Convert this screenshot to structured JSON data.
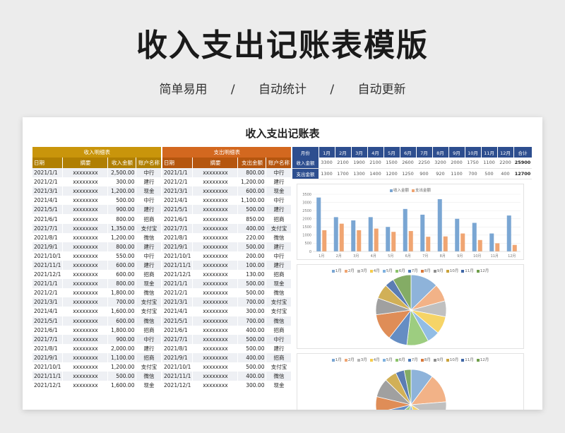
{
  "header": {
    "title": "收入支出记账表模版",
    "taglines": [
      "简单易用",
      "/",
      "自动统计",
      "/",
      "自动更新"
    ]
  },
  "sheet": {
    "title": "收入支出记账表",
    "income": {
      "section_title": "收入明细表",
      "columns": [
        "日期",
        "摘要",
        "收入金额",
        "账户名称"
      ],
      "rows": [
        [
          "2021/1/1",
          "xxxxxxxx",
          "2,500.00",
          "中行"
        ],
        [
          "2021/2/1",
          "xxxxxxxx",
          "300.00",
          "建行"
        ],
        [
          "2021/3/1",
          "xxxxxxxx",
          "1,200.00",
          "现金"
        ],
        [
          "2021/4/1",
          "xxxxxxxx",
          "500.00",
          "中行"
        ],
        [
          "2021/5/1",
          "xxxxxxxx",
          "900.00",
          "建行"
        ],
        [
          "2021/6/1",
          "xxxxxxxx",
          "800.00",
          "招商"
        ],
        [
          "2021/7/1",
          "xxxxxxxx",
          "1,350.00",
          "支付宝"
        ],
        [
          "2021/8/1",
          "xxxxxxxx",
          "1,200.00",
          "微信"
        ],
        [
          "2021/9/1",
          "xxxxxxxx",
          "800.00",
          "建行"
        ],
        [
          "2021/10/1",
          "xxxxxxxx",
          "550.00",
          "中行"
        ],
        [
          "2021/11/1",
          "xxxxxxxx",
          "600.00",
          "建行"
        ],
        [
          "2021/12/1",
          "xxxxxxxx",
          "600.00",
          "招商"
        ],
        [
          "2021/1/1",
          "xxxxxxxx",
          "800.00",
          "现金"
        ],
        [
          "2021/2/1",
          "xxxxxxxx",
          "1,800.00",
          "微信"
        ],
        [
          "2021/3/1",
          "xxxxxxxx",
          "700.00",
          "支付宝"
        ],
        [
          "2021/4/1",
          "xxxxxxxx",
          "1,600.00",
          "支付宝"
        ],
        [
          "2021/5/1",
          "xxxxxxxx",
          "600.00",
          "微信"
        ],
        [
          "2021/6/1",
          "xxxxxxxx",
          "1,800.00",
          "招商"
        ],
        [
          "2021/7/1",
          "xxxxxxxx",
          "900.00",
          "中行"
        ],
        [
          "2021/8/1",
          "xxxxxxxx",
          "2,000.00",
          "建行"
        ],
        [
          "2021/9/1",
          "xxxxxxxx",
          "1,100.00",
          "招商"
        ],
        [
          "2021/10/1",
          "xxxxxxxx",
          "1,200.00",
          "支付宝"
        ],
        [
          "2021/11/1",
          "xxxxxxxx",
          "500.00",
          "微信"
        ],
        [
          "2021/12/1",
          "xxxxxxxx",
          "1,600.00",
          "现金"
        ]
      ]
    },
    "expense": {
      "section_title": "支出明细表",
      "columns": [
        "日期",
        "摘要",
        "支出金额",
        "账户名称"
      ],
      "rows": [
        [
          "2021/1/1",
          "xxxxxxxx",
          "800.00",
          "中行"
        ],
        [
          "2021/2/1",
          "xxxxxxxx",
          "1,200.00",
          "建行"
        ],
        [
          "2021/3/1",
          "xxxxxxxx",
          "600.00",
          "现金"
        ],
        [
          "2021/4/1",
          "xxxxxxxx",
          "1,100.00",
          "中行"
        ],
        [
          "2021/5/1",
          "xxxxxxxx",
          "500.00",
          "建行"
        ],
        [
          "2021/6/1",
          "xxxxxxxx",
          "850.00",
          "招商"
        ],
        [
          "2021/7/1",
          "xxxxxxxx",
          "400.00",
          "支付宝"
        ],
        [
          "2021/8/1",
          "xxxxxxxx",
          "220.00",
          "微信"
        ],
        [
          "2021/9/1",
          "xxxxxxxx",
          "500.00",
          "建行"
        ],
        [
          "2021/10/1",
          "xxxxxxxx",
          "200.00",
          "中行"
        ],
        [
          "2021/11/1",
          "xxxxxxxx",
          "100.00",
          "建行"
        ],
        [
          "2021/12/1",
          "xxxxxxxx",
          "130.00",
          "招商"
        ],
        [
          "2021/1/1",
          "xxxxxxxx",
          "500.00",
          "现金"
        ],
        [
          "2021/2/1",
          "xxxxxxxx",
          "500.00",
          "微信"
        ],
        [
          "2021/3/1",
          "xxxxxxxx",
          "700.00",
          "支付宝"
        ],
        [
          "2021/4/1",
          "xxxxxxxx",
          "300.00",
          "支付宝"
        ],
        [
          "2021/5/1",
          "xxxxxxxx",
          "700.00",
          "微信"
        ],
        [
          "2021/6/1",
          "xxxxxxxx",
          "400.00",
          "招商"
        ],
        [
          "2021/7/1",
          "xxxxxxxx",
          "500.00",
          "中行"
        ],
        [
          "2021/8/1",
          "xxxxxxxx",
          "500.00",
          "建行"
        ],
        [
          "2021/9/1",
          "xxxxxxxx",
          "400.00",
          "招商"
        ],
        [
          "2021/10/1",
          "xxxxxxxx",
          "500.00",
          "支付宝"
        ],
        [
          "2021/11/1",
          "xxxxxxxx",
          "400.00",
          "微信"
        ],
        [
          "2021/12/1",
          "xxxxxxxx",
          "300.00",
          "现金"
        ]
      ]
    },
    "summary": {
      "columns": [
        "月份",
        "1月",
        "2月",
        "3月",
        "4月",
        "5月",
        "6月",
        "7月",
        "8月",
        "9月",
        "10月",
        "11月",
        "12月",
        "合计"
      ],
      "rows": [
        {
          "label": "收入金额",
          "values": [
            "3300",
            "2100",
            "1900",
            "2100",
            "1500",
            "2600",
            "2250",
            "3200",
            "2000",
            "1750",
            "1100",
            "2200"
          ],
          "total": "25900"
        },
        {
          "label": "支出金额",
          "values": [
            "1300",
            "1700",
            "1300",
            "1400",
            "1200",
            "1250",
            "900",
            "920",
            "1100",
            "700",
            "500",
            "400"
          ],
          "total": "12700"
        }
      ]
    }
  },
  "chart_data": [
    {
      "type": "bar",
      "categories": [
        "1月",
        "2月",
        "3月",
        "4月",
        "5月",
        "6月",
        "7月",
        "8月",
        "9月",
        "10月",
        "11月",
        "12月"
      ],
      "series": [
        {
          "name": "收入金额",
          "values": [
            3300,
            2100,
            1900,
            2100,
            1500,
            2600,
            2250,
            3200,
            2000,
            1750,
            1100,
            2200
          ],
          "color": "#7aa6d3"
        },
        {
          "name": "支出金额",
          "values": [
            1300,
            1700,
            1300,
            1400,
            1200,
            1250,
            900,
            920,
            1100,
            700,
            500,
            400
          ],
          "color": "#f0a572"
        }
      ],
      "ylim": [
        0,
        3500
      ],
      "yticks": [
        "0",
        "500",
        "1000",
        "1500",
        "2000",
        "2500",
        "3000",
        "3500"
      ],
      "grid": true,
      "legend": "top"
    },
    {
      "type": "pie",
      "categories": [
        "1月",
        "2月",
        "3月",
        "4月",
        "5月",
        "6月",
        "7月",
        "8月",
        "9月",
        "10月",
        "11月",
        "12月"
      ],
      "values": [
        3300,
        2100,
        1900,
        2100,
        1500,
        2600,
        2250,
        3200,
        2000,
        1750,
        1100,
        2200
      ],
      "legend": "top"
    },
    {
      "type": "pie",
      "categories": [
        "1月",
        "2月",
        "3月",
        "4月",
        "5月",
        "6月",
        "7月",
        "8月",
        "9月",
        "10月",
        "11月",
        "12月"
      ],
      "values": [
        1300,
        1700,
        1300,
        1400,
        1200,
        1250,
        900,
        920,
        1100,
        700,
        500,
        400
      ],
      "legend": "top"
    }
  ],
  "pie_colors": [
    "#7aa6d3",
    "#f0a572",
    "#b5b5b5",
    "#f5cc4c",
    "#7fb2e0",
    "#8cc46a",
    "#4a79b8",
    "#d9793a",
    "#8f8f8f",
    "#c9a23a",
    "#3e66a6",
    "#6f9e4a"
  ]
}
